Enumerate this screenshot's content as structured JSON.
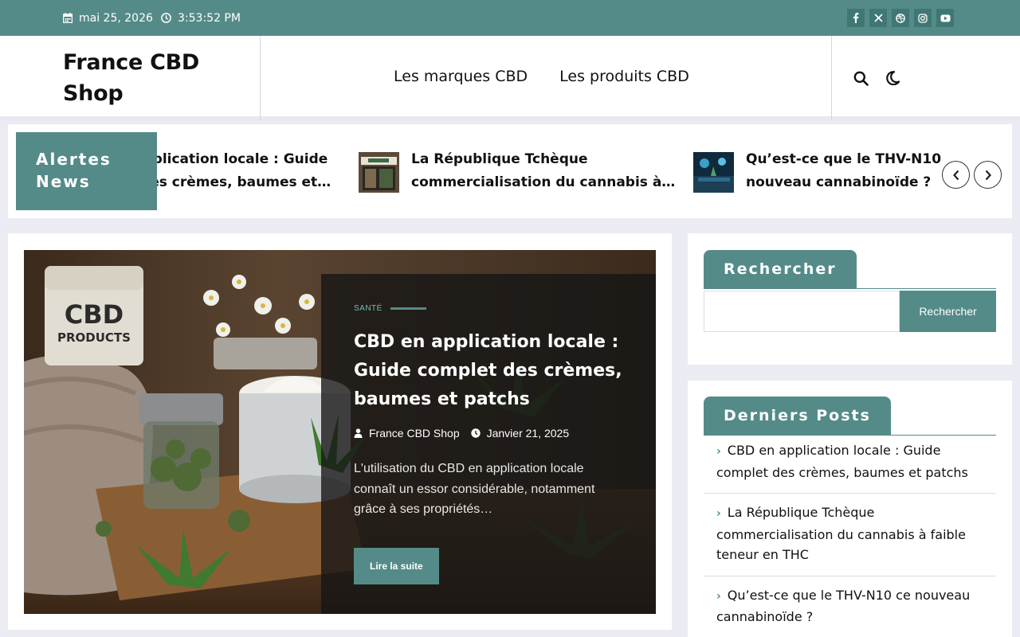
{
  "topbar": {
    "date": "mai 25, 2026",
    "time": "3:53:52 PM",
    "socials": [
      "facebook-icon",
      "x-icon",
      "dribbble-icon",
      "instagram-icon",
      "youtube-icon"
    ]
  },
  "header": {
    "site_title_line1": "France CBD",
    "site_title_line2": "Shop",
    "nav": [
      "Les marques CBD",
      "Les produits CBD"
    ]
  },
  "ticker": {
    "label_line1": "Alertes",
    "label_line2": "News",
    "items": [
      {
        "line1": "CBD en application locale : Guide",
        "line2": "complet des crèmes, baumes et…"
      },
      {
        "line1": "La République Tchèque",
        "line2": "commercialisation du cannabis à…"
      },
      {
        "line1": "Qu’est-ce que le THV-N10 ce",
        "line2": "nouveau cannabinoïde ?"
      }
    ]
  },
  "featured": {
    "category": "SANTÉ",
    "title": "CBD en application locale : Guide complet des crèmes, baumes et patchs",
    "author": "France CBD Shop",
    "date": "Janvier 21, 2025",
    "excerpt": "L'utilisation du CBD en application locale connaît un essor considérable, notamment grâce à ses propriétés…",
    "read_more": "Lire la suite",
    "image_text_1": "CBD",
    "image_text_2": "PRODUCTS"
  },
  "sidebar": {
    "search_title": "Rechercher",
    "search_placeholder": "",
    "search_button": "Rechercher",
    "recent_title": "Derniers Posts",
    "recent_posts": [
      "CBD en application locale : Guide complet des crèmes, baumes et patchs",
      "La République Tchèque commercialisation du cannabis à faible teneur en THC",
      "Qu’est-ce que le THV-N10 ce nouveau cannabinoïde ?"
    ]
  },
  "colors": {
    "primary": "#548b88",
    "dark_overlay": "#141414",
    "background": "#ebebf3"
  }
}
